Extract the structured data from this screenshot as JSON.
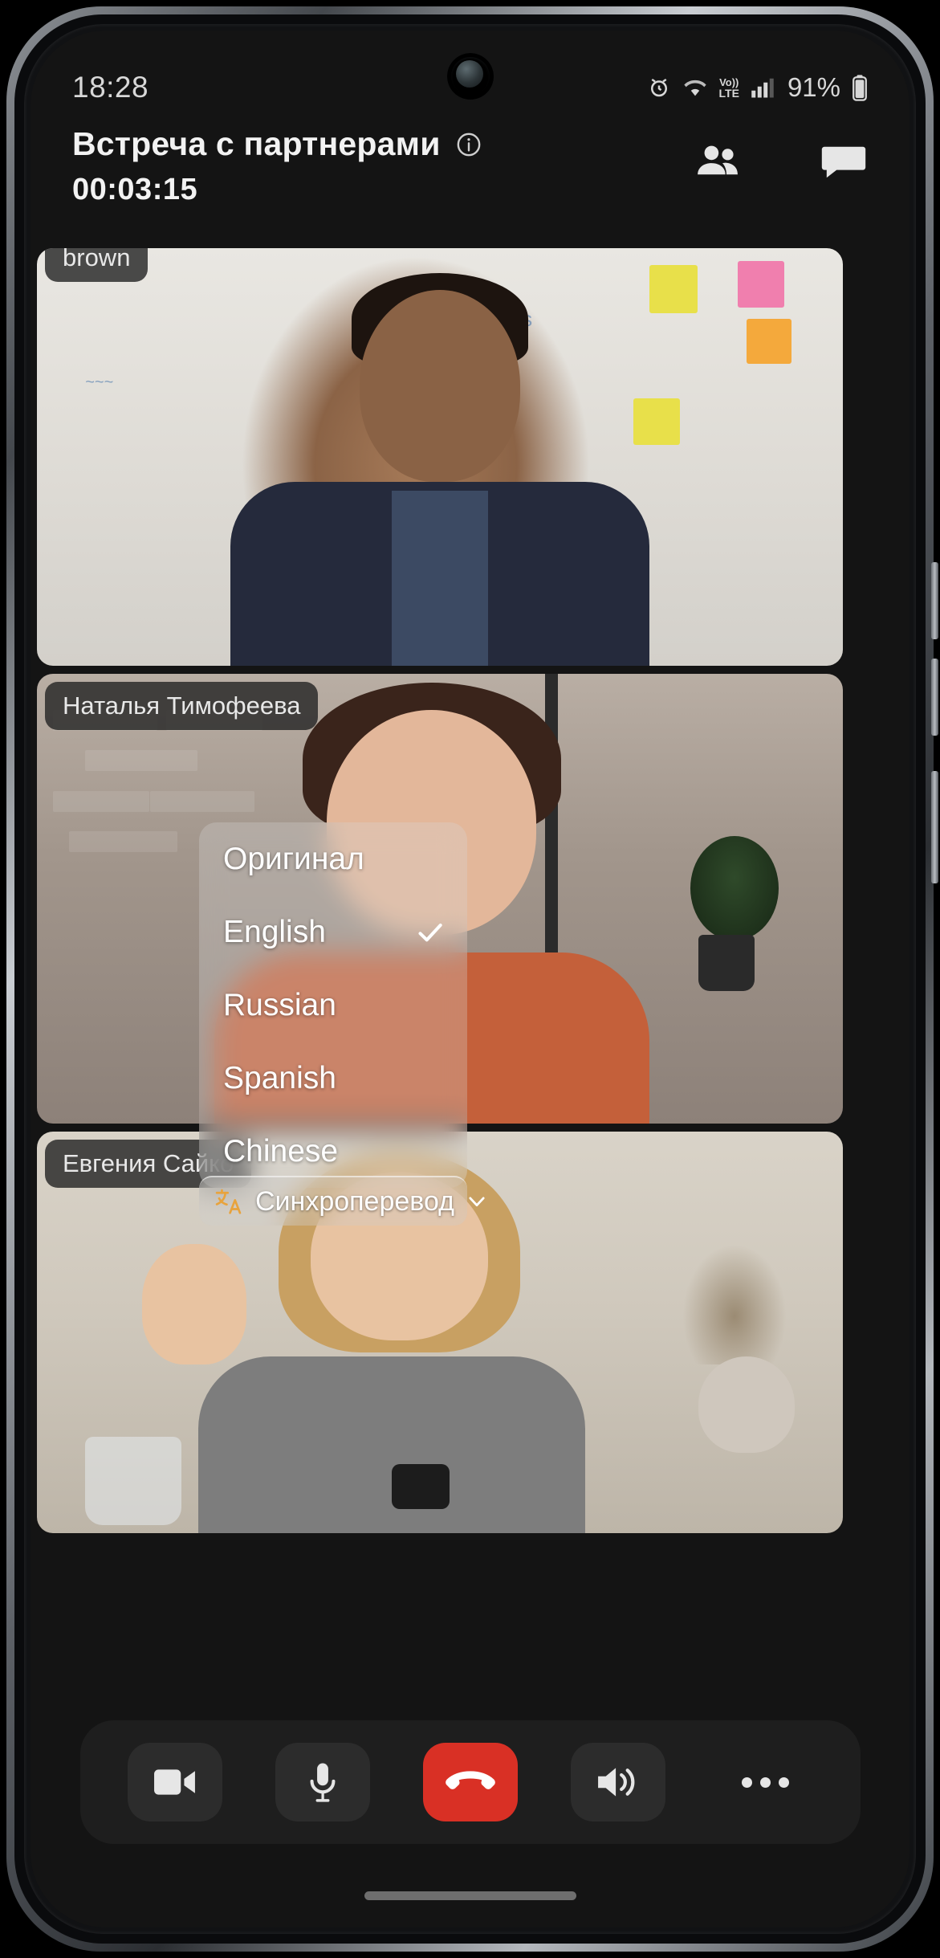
{
  "status_bar": {
    "clock": "18:28",
    "battery_percent": "91%",
    "volte_top": "Vo))",
    "volte_bottom": "LTE",
    "icons": [
      "alarm-icon",
      "wifi-icon",
      "volte-icon",
      "signal-icon",
      "battery-icon"
    ]
  },
  "header": {
    "title": "Встреча с партнерами",
    "info_icon": "info-icon",
    "timer": "00:03:15",
    "participants_icon": "participants-icon",
    "chat_icon": "chat-icon"
  },
  "tiles": [
    {
      "name": "brown"
    },
    {
      "name": "Наталья Тимофеева"
    },
    {
      "name": "Евгения Сайко"
    }
  ],
  "language_menu": {
    "items": [
      {
        "label": "Оригинал",
        "selected": false
      },
      {
        "label": "English",
        "selected": true
      },
      {
        "label": "Russian",
        "selected": false
      },
      {
        "label": "Spanish",
        "selected": false
      },
      {
        "label": "Chinese",
        "selected": false
      }
    ],
    "check_icon": "check-icon"
  },
  "sync_button": {
    "label": "Синхроперевод",
    "icon": "translate-icon",
    "chevron": "chevron-down-icon",
    "accent_color": "#e8a33d"
  },
  "controls": [
    {
      "name": "camera-toggle",
      "icon": "video-camera-icon"
    },
    {
      "name": "mic-toggle",
      "icon": "microphone-icon"
    },
    {
      "name": "end-call",
      "icon": "phone-hangup-icon",
      "color": "#d93025"
    },
    {
      "name": "speaker-toggle",
      "icon": "speaker-icon"
    },
    {
      "name": "more-options",
      "icon": "ellipsis-icon"
    }
  ]
}
